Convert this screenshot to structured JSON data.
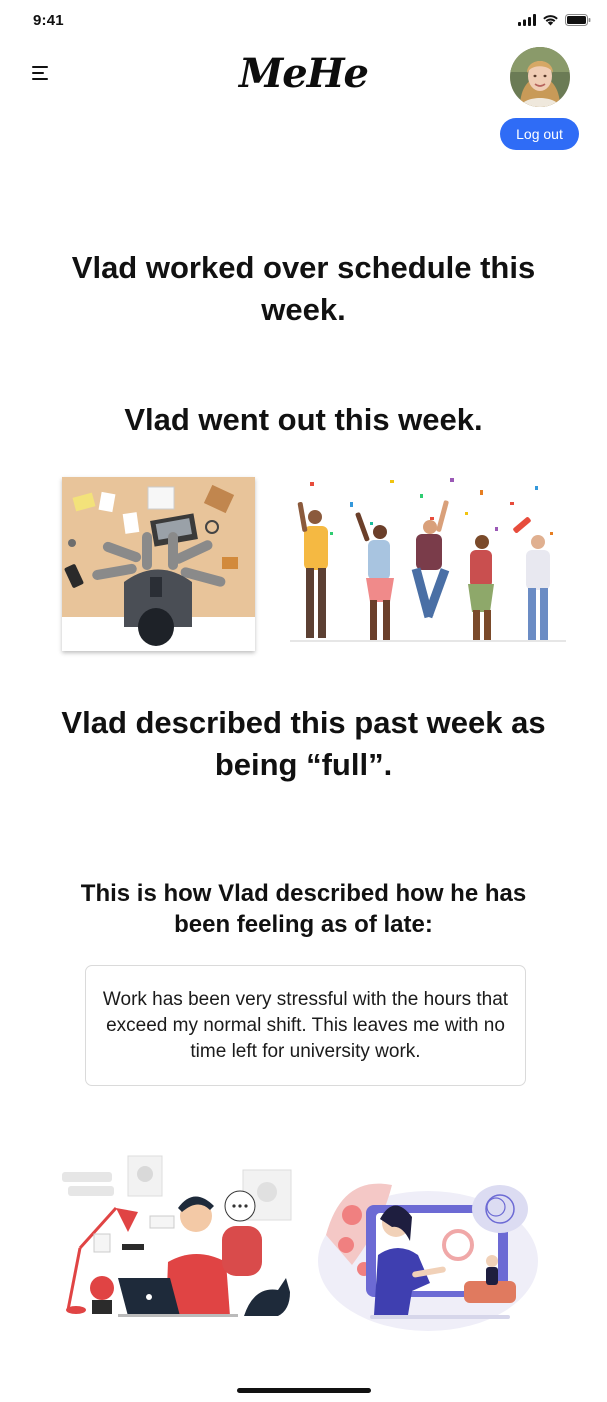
{
  "status_bar": {
    "time": "9:41"
  },
  "header": {
    "logo": "MeHe",
    "logout_label": "Log out"
  },
  "content": {
    "line_schedule": "Vlad worked over schedule this week.",
    "line_went_out": "Vlad went out this week.",
    "line_described": "Vlad described this past week as being “full”.",
    "feeling_heading": "This is how Vlad described how he has been feeling as of late:",
    "feeling_text": "Work has been very stressful with the hours that exceed my normal shift. This leaves me with no time left for university work."
  },
  "colors": {
    "accent": "#2f6cf6"
  },
  "icons": [
    "menu-icon",
    "signal-icon",
    "wifi-icon",
    "battery-icon"
  ]
}
